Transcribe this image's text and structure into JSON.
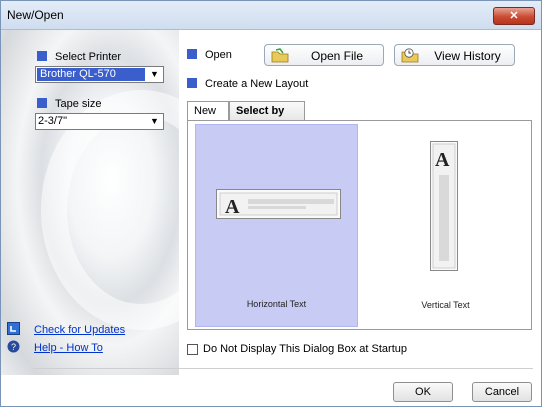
{
  "window": {
    "title": "New/Open",
    "close_label": "✕"
  },
  "left": {
    "printer_label": "Select Printer",
    "printer_value": "Brother QL-570",
    "tape_label": "Tape size",
    "tape_value": "2-3/7\"",
    "check_updates": "Check for Updates",
    "help": "Help - How To"
  },
  "right": {
    "open_label": "Open",
    "open_file_button": "Open File",
    "view_history_button": "View History",
    "create_label": "Create a New Layout",
    "tabs": [
      {
        "label": "New"
      },
      {
        "label": "Select by Use"
      }
    ],
    "options": [
      {
        "label": "Horizontal Text",
        "glyph": "A"
      },
      {
        "label": "Vertical Text",
        "glyph": "A"
      }
    ],
    "startup_checkbox_label": "Do Not Display This Dialog Box at Startup"
  },
  "footer": {
    "ok": "OK",
    "cancel": "Cancel"
  },
  "colors": {
    "accent": "#3a5fcd",
    "selection": "#c8ccf5",
    "link": "#0033cc"
  }
}
